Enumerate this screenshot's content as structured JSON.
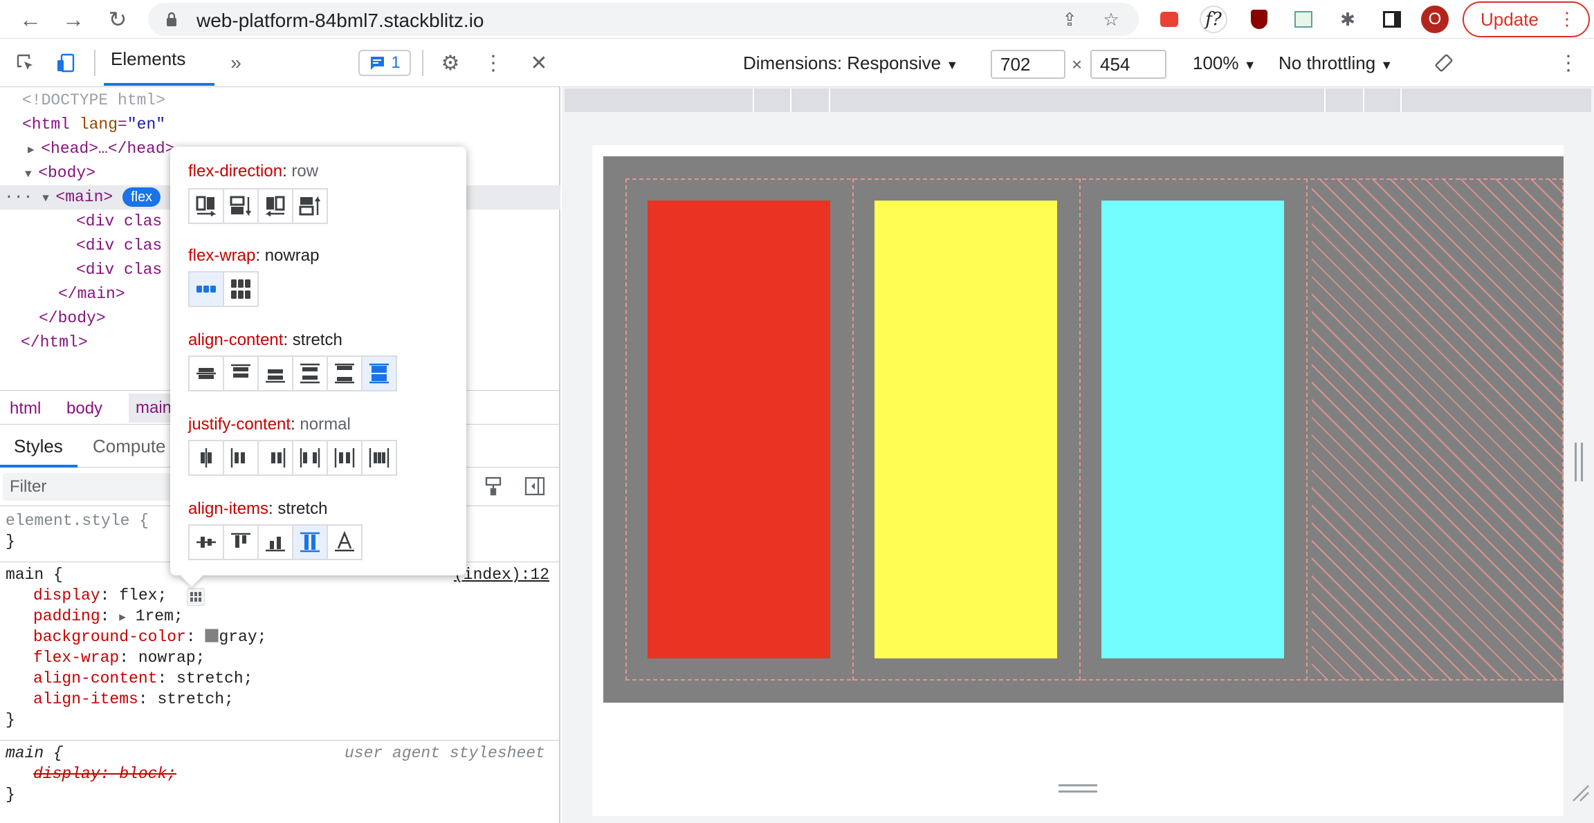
{
  "browser": {
    "url": "web-platform-84bml7.stackblitz.io",
    "profile_initial": "O",
    "update_label": "Update",
    "ext_f_label": "f?"
  },
  "devtools": {
    "tab_elements": "Elements",
    "issues_count": "1",
    "dom": {
      "doctype": "<!DOCTYPE html>",
      "html_open": "<html",
      "html_attr": "lang",
      "html_val": "\"en\"",
      "head": "<head>…</head>",
      "body_open": "<body>",
      "main_open": "<main>",
      "flex_badge": "flex",
      "div1": "<div clas",
      "div2": "<div clas",
      "div3": "<div clas",
      "main_close": "</main>",
      "body_close": "</body>",
      "html_close": "</html>"
    },
    "crumbs": [
      "html",
      "body",
      "main"
    ],
    "styles_tab": "Styles",
    "computed_tab": "Compute",
    "filter_placeholder": "Filter",
    "rules": {
      "element_style": "element.style {",
      "close": "}",
      "main_selector": "main {",
      "source": "(index):12",
      "decls": [
        {
          "prop": "display",
          "value": "flex;"
        },
        {
          "prop": "padding",
          "value": "1rem;"
        },
        {
          "prop": "background-color",
          "value": "gray;"
        },
        {
          "prop": "flex-wrap",
          "value": "nowrap;"
        },
        {
          "prop": "align-content",
          "value": "stretch;"
        },
        {
          "prop": "align-items",
          "value": "stretch;"
        }
      ],
      "ua_selector": "main {",
      "ua_source": "user agent stylesheet",
      "ua_decl": "display: block;"
    }
  },
  "flex_editor": {
    "flex_direction": {
      "name": "flex-direction",
      "value": "row"
    },
    "flex_wrap": {
      "name": "flex-wrap",
      "value": "nowrap"
    },
    "align_content": {
      "name": "align-content",
      "value": "stretch"
    },
    "justify_content": {
      "name": "justify-content",
      "value": "normal"
    },
    "align_items": {
      "name": "align-items",
      "value": "stretch"
    }
  },
  "viewport": {
    "dimensions_label": "Dimensions: Responsive",
    "width": "702",
    "height": "454",
    "zoom": "100%",
    "throttling": "No throttling",
    "times": "×"
  },
  "colors": {
    "accent": "#1a73e8",
    "item1": "#e93323",
    "item2": "#fffc53",
    "item3": "#73fdfe",
    "container": "#808080"
  }
}
